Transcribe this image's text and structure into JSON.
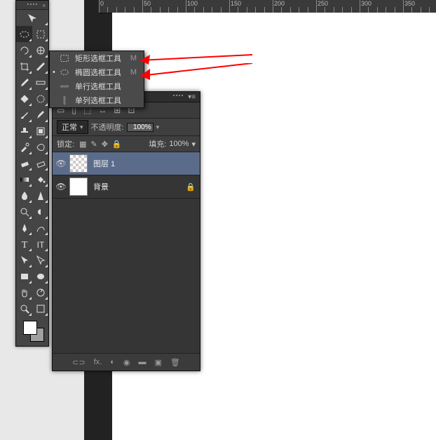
{
  "ruler": {
    "start": 0,
    "step": 50,
    "count": 8
  },
  "tool_flyout": {
    "items": [
      {
        "icon": "rect-marquee-icon",
        "label": "矩形选框工具",
        "shortcut": "M",
        "selected": false
      },
      {
        "icon": "ellipse-marquee-icon",
        "label": "椭圆选框工具",
        "shortcut": "M",
        "selected": true
      },
      {
        "icon": "single-row-marquee-icon",
        "label": "单行选框工具",
        "shortcut": "",
        "selected": false
      },
      {
        "icon": "single-col-marquee-icon",
        "label": "单列选框工具",
        "shortcut": "",
        "selected": false
      }
    ]
  },
  "panel": {
    "option_icons": [
      "▭",
      "▯",
      "⬚",
      "↔",
      "⊞",
      "⊡"
    ],
    "blend_mode": "正常",
    "opacity_label": "不透明度:",
    "opacity_value": "100%",
    "lock_label": "锁定:",
    "lock_icons": [
      "▦",
      "✎",
      "✥",
      "🔒"
    ],
    "fill_label": "填充:",
    "fill_value": "100%",
    "layers": [
      {
        "visible": true,
        "thumb": "checker",
        "name": "图层 1",
        "locked": false,
        "selected": true
      },
      {
        "visible": true,
        "thumb": "white",
        "name": "背景",
        "locked": true,
        "selected": false
      }
    ],
    "footer_icons": [
      "⊂⊃",
      "fx.",
      "◐",
      "◉",
      "▬",
      "▣",
      "🗑"
    ]
  },
  "toolbar": {
    "header_arrows": "»",
    "rows": [
      [
        "move-icon"
      ],
      [
        "marquee-icon",
        "crop2-icon"
      ],
      [
        "lasso-icon",
        "quick-select-icon"
      ],
      [
        "crop-icon",
        "slice-icon"
      ],
      [
        "eyedropper-icon",
        "ruler-icon"
      ],
      [
        "healing-icon",
        "patch-icon"
      ],
      [
        "brush-icon",
        "pencil-icon"
      ],
      [
        "stamp-icon",
        "pattern-icon"
      ],
      [
        "history-brush-icon",
        "art-history-icon"
      ],
      [
        "eraser-icon",
        "bg-eraser-icon"
      ],
      [
        "gradient-icon",
        "bucket-icon"
      ],
      [
        "blur-icon",
        "sharpen-icon"
      ],
      [
        "dodge-icon",
        "burn-icon"
      ],
      [
        "pen-icon",
        "freeform-pen-icon"
      ],
      [
        "type-icon",
        "vtype-icon"
      ],
      [
        "path-select-icon",
        "direct-select-icon"
      ],
      [
        "rectangle-icon",
        "ellipse-shape-icon"
      ],
      [
        "hand-icon",
        "rotate-view-icon"
      ],
      [
        "zoom-icon",
        "notes-icon"
      ]
    ]
  }
}
